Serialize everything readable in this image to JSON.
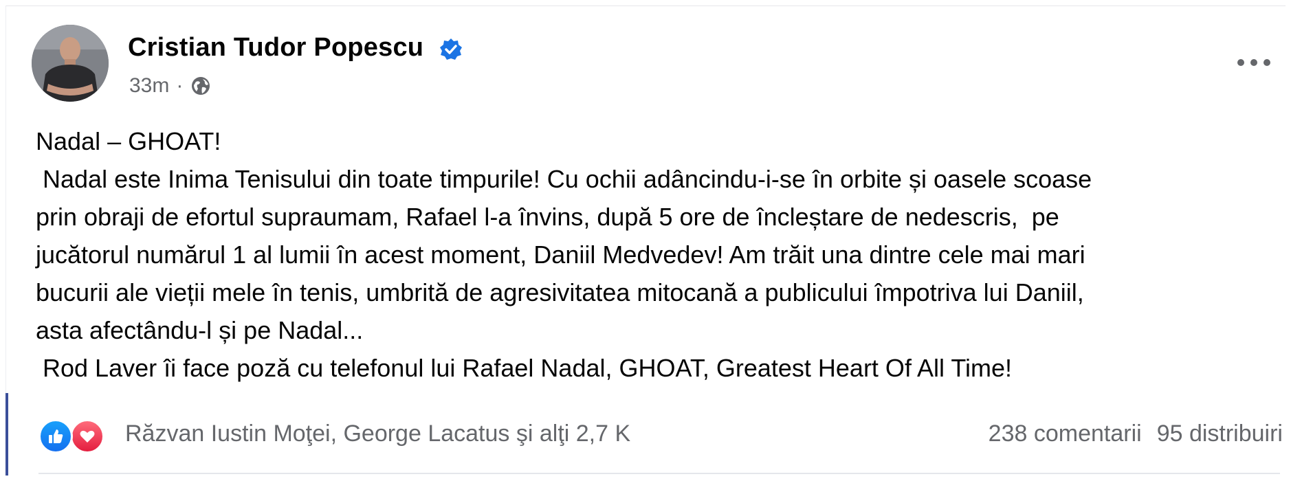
{
  "post": {
    "author": "Cristian Tudor Popescu",
    "time": "33m",
    "separator": "·",
    "privacy_icon": "globe-icon",
    "verified_icon": "verified-badge-icon",
    "more_icon": "more-options-icon"
  },
  "body": {
    "lines": [
      "Nadal – GHOAT!",
      " Nadal este Inima Tenisului din toate timpurile! Cu ochii adâncindu-i-se în orbite și oasele scoase",
      "prin obraji de efortul supraumam, Rafael l-a învins, după 5 ore de încleștare de nedescris,  pe",
      "jucătorul numărul 1 al lumii în acest moment, Daniil Medvedev! Am trăit una dintre cele mai mari",
      "bucurii ale vieții mele în tenis, umbrită de agresivitatea mitocană a publicului împotriva lui Daniil,",
      "asta afectându-l și pe Nadal...",
      " Rod Laver îi face poză cu telefonul lui Rafael Nadal, GHOAT, Greatest Heart Of All Time!"
    ]
  },
  "footer": {
    "reactions": [
      "like-icon",
      "love-icon"
    ],
    "reactors": "Răzvan Iustin Moţei, George Lacatus şi alţi 2,7 K",
    "comments": "238 comentarii",
    "shares": "95 distribuiri"
  },
  "colors": {
    "text": "#050505",
    "secondary": "#65676b",
    "verified": "#1b74e4",
    "like": "#1877f2",
    "love": "#f33e58"
  }
}
